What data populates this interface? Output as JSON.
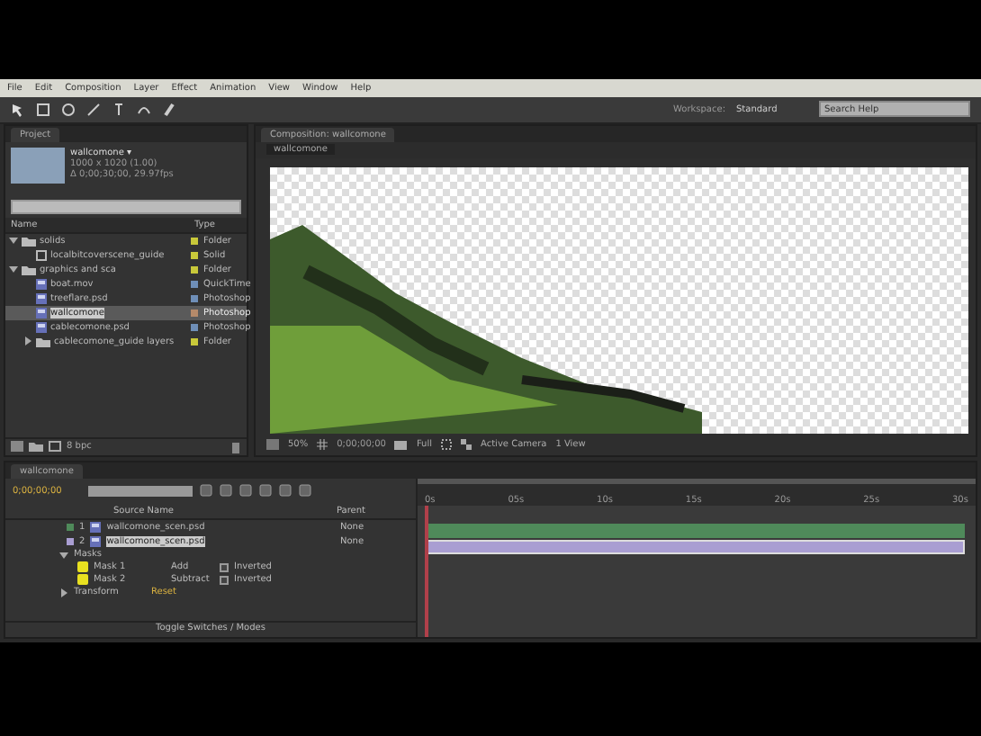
{
  "menu": [
    "File",
    "Edit",
    "Composition",
    "Layer",
    "Effect",
    "Animation",
    "View",
    "Window",
    "Help"
  ],
  "workspace": {
    "label": "Workspace:",
    "value": "Standard"
  },
  "help_search": {
    "placeholder": "Search Help"
  },
  "project": {
    "tab": "Project",
    "footage_name": "wallcomone ▾",
    "footage_info": [
      "1000 x 1020 (1.00)",
      "Δ 0;00;30;00, 29.97fps"
    ],
    "columns": [
      "Name",
      "Type"
    ],
    "items": [
      {
        "kind": "folder",
        "name": "solids",
        "type": "Folder",
        "color": "#c8c83a",
        "selected": false,
        "expanded": true,
        "children": [
          {
            "kind": "solid",
            "name": "localbitcoverscene_guide",
            "type": "Solid",
            "color": "#c8c83a",
            "selected": false
          }
        ]
      },
      {
        "kind": "folder",
        "name": "graphics and sca",
        "type": "Folder",
        "color": "#c8c83a",
        "selected": false,
        "expanded": true,
        "children": [
          {
            "kind": "footage",
            "name": "boat.mov",
            "type": "QuickTime",
            "color": "#6f8fb8",
            "selected": false
          },
          {
            "kind": "footage",
            "name": "treeflare.psd",
            "type": "Photoshop",
            "color": "#6f8fb8",
            "selected": false
          },
          {
            "kind": "footage",
            "name": "wallcomone",
            "type": "Photoshop",
            "color": "#b58a6a",
            "selected": true
          },
          {
            "kind": "footage",
            "name": "cablecomone.psd",
            "type": "Photoshop",
            "color": "#6f8fb8",
            "selected": false
          },
          {
            "kind": "folder",
            "name": "cablecomone_guide layers",
            "type": "Folder",
            "color": "#c8c83a",
            "selected": false,
            "expanded": false
          }
        ]
      }
    ],
    "bpc": "8 bpc"
  },
  "comp": {
    "tab": "Composition: wallcomone",
    "subtab": "wallcomone",
    "zoom": "50%",
    "time": "0;00;00;00",
    "resolution": "Full",
    "camera": "Active Camera",
    "views": "1 View"
  },
  "timeline": {
    "tab": "wallcomone",
    "timecode": "0;00;00;00",
    "columns": [
      "Source Name",
      "Parent"
    ],
    "layers": [
      {
        "number": "1",
        "name": "wallcomone_scen.psd",
        "parent": "None",
        "selected": false,
        "color": "#4f8a5a"
      },
      {
        "number": "2",
        "name": "wallcomone_scen.psd",
        "parent": "None",
        "selected": true,
        "color": "#a99ed2"
      }
    ],
    "properties": [
      {
        "name": "Masks",
        "expanded": true,
        "children": [
          {
            "name": "Mask 1",
            "mode": "Add",
            "inverted": "Inverted",
            "checked": false
          },
          {
            "name": "Mask 2",
            "mode": "Subtract",
            "inverted": "Inverted",
            "checked": false
          }
        ]
      },
      {
        "name": "Transform",
        "expanded": false,
        "value": "Reset"
      }
    ],
    "ruler": [
      "0s",
      "05s",
      "10s",
      "15s",
      "20s",
      "25s",
      "30s"
    ],
    "footer": "Toggle Switches / Modes"
  }
}
